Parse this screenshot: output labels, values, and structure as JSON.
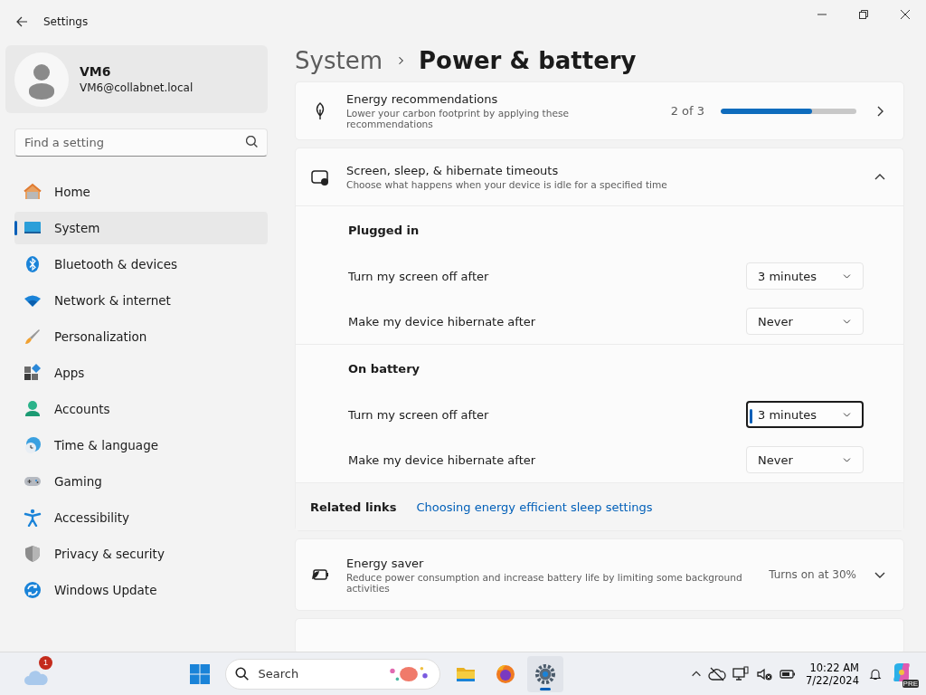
{
  "window": {
    "title": "Settings"
  },
  "account": {
    "name": "VM6",
    "email": "VM6@collabnet.local"
  },
  "search": {
    "placeholder": "Find a setting"
  },
  "nav": [
    {
      "label": "Home",
      "selected": false
    },
    {
      "label": "System",
      "selected": true
    },
    {
      "label": "Bluetooth & devices",
      "selected": false
    },
    {
      "label": "Network & internet",
      "selected": false
    },
    {
      "label": "Personalization",
      "selected": false
    },
    {
      "label": "Apps",
      "selected": false
    },
    {
      "label": "Accounts",
      "selected": false
    },
    {
      "label": "Time & language",
      "selected": false
    },
    {
      "label": "Gaming",
      "selected": false
    },
    {
      "label": "Accessibility",
      "selected": false
    },
    {
      "label": "Privacy & security",
      "selected": false
    },
    {
      "label": "Windows Update",
      "selected": false
    }
  ],
  "breadcrumb": [
    "System",
    "Power & battery"
  ],
  "recommendations": {
    "title": "Energy recommendations",
    "description": "Lower your carbon footprint by applying these recommendations",
    "progress": "2 of 3",
    "level": 0.67
  },
  "timeouts": {
    "title": "Screen, sleep, & hibernate timeouts",
    "description": "Choose what happens when your device is idle for a specified time",
    "expanded": true,
    "groups": [
      {
        "heading": "Plugged in",
        "rows": [
          {
            "label": "Turn my screen off after",
            "value": "3 minutes",
            "focused": false
          },
          {
            "label": "Make my device hibernate after",
            "value": "Never",
            "focused": false
          }
        ]
      },
      {
        "heading": "On battery",
        "rows": [
          {
            "label": "Turn my screen off after",
            "value": "3 minutes",
            "focused": true
          },
          {
            "label": "Make my device hibernate after",
            "value": "Never",
            "focused": false
          }
        ]
      }
    ]
  },
  "related": {
    "label": "Related links",
    "link": "Choosing energy efficient sleep settings"
  },
  "energy_saver": {
    "title": "Energy saver",
    "description": "Reduce power consumption and increase battery life by limiting some background activities",
    "status": "Turns on at 30%",
    "expanded": false
  },
  "taskbar": {
    "weather_badge": "1",
    "search_placeholder": "Search",
    "apps": [
      {
        "selected": false
      },
      {
        "selected": false
      },
      {
        "selected": true
      }
    ],
    "time": "10:22 AM",
    "date": "7/22/2024",
    "copilot_badge": "PRE"
  }
}
